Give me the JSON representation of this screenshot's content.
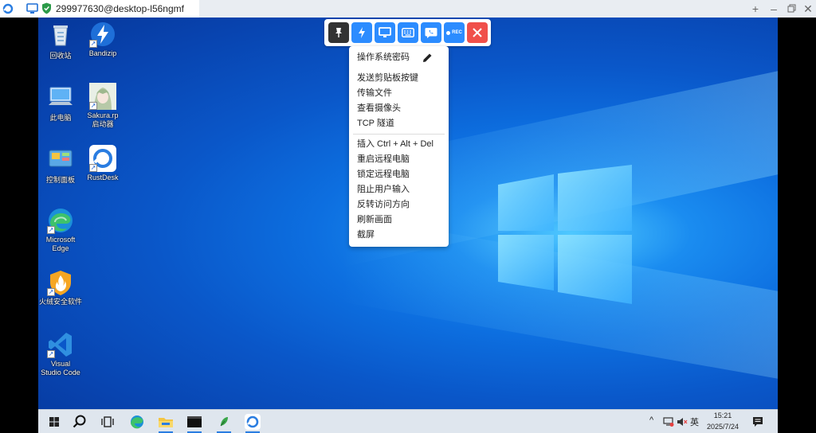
{
  "titlebar": {
    "connection_title": "299977630@desktop-l56ngmf",
    "icons": [
      "rustdesk-logo",
      "monitor-icon",
      "shield-icon"
    ],
    "window_controls": [
      "add-tab",
      "minimize",
      "restore",
      "close"
    ]
  },
  "desktop": {
    "icons": [
      {
        "label": "回收站"
      },
      {
        "label": "Bandizip"
      },
      {
        "label": "此电脑"
      },
      {
        "label_line1": "Sakura.rp",
        "label_line2": "启动器"
      },
      {
        "label": "控制面板"
      },
      {
        "label": "RustDesk"
      },
      {
        "label_line1": "Microsoft",
        "label_line2": "Edge"
      },
      {
        "label": "火绒安全软件"
      },
      {
        "label_line1": "Visual",
        "label_line2": "Studio Code"
      }
    ]
  },
  "toolbar": {
    "buttons": [
      "pin",
      "action",
      "display",
      "keyboard",
      "chat",
      "record",
      "close"
    ],
    "rec_label": "REC",
    "colors": {
      "pin": "#333333",
      "blue": "#2c8cff",
      "close": "#f0504a"
    }
  },
  "menu": {
    "items": [
      "操作系统密码",
      "发送剪贴板按键",
      "传输文件",
      "查看摄像头",
      "TCP 隧道",
      "插入 Ctrl + Alt + Del",
      "重启远程电脑",
      "锁定远程电脑",
      "阻止用户输入",
      "反转访问方向",
      "刷新画面",
      "截屏"
    ]
  },
  "taskbar": {
    "time": "15:21",
    "date": "2025/7/24",
    "ime": "英"
  }
}
